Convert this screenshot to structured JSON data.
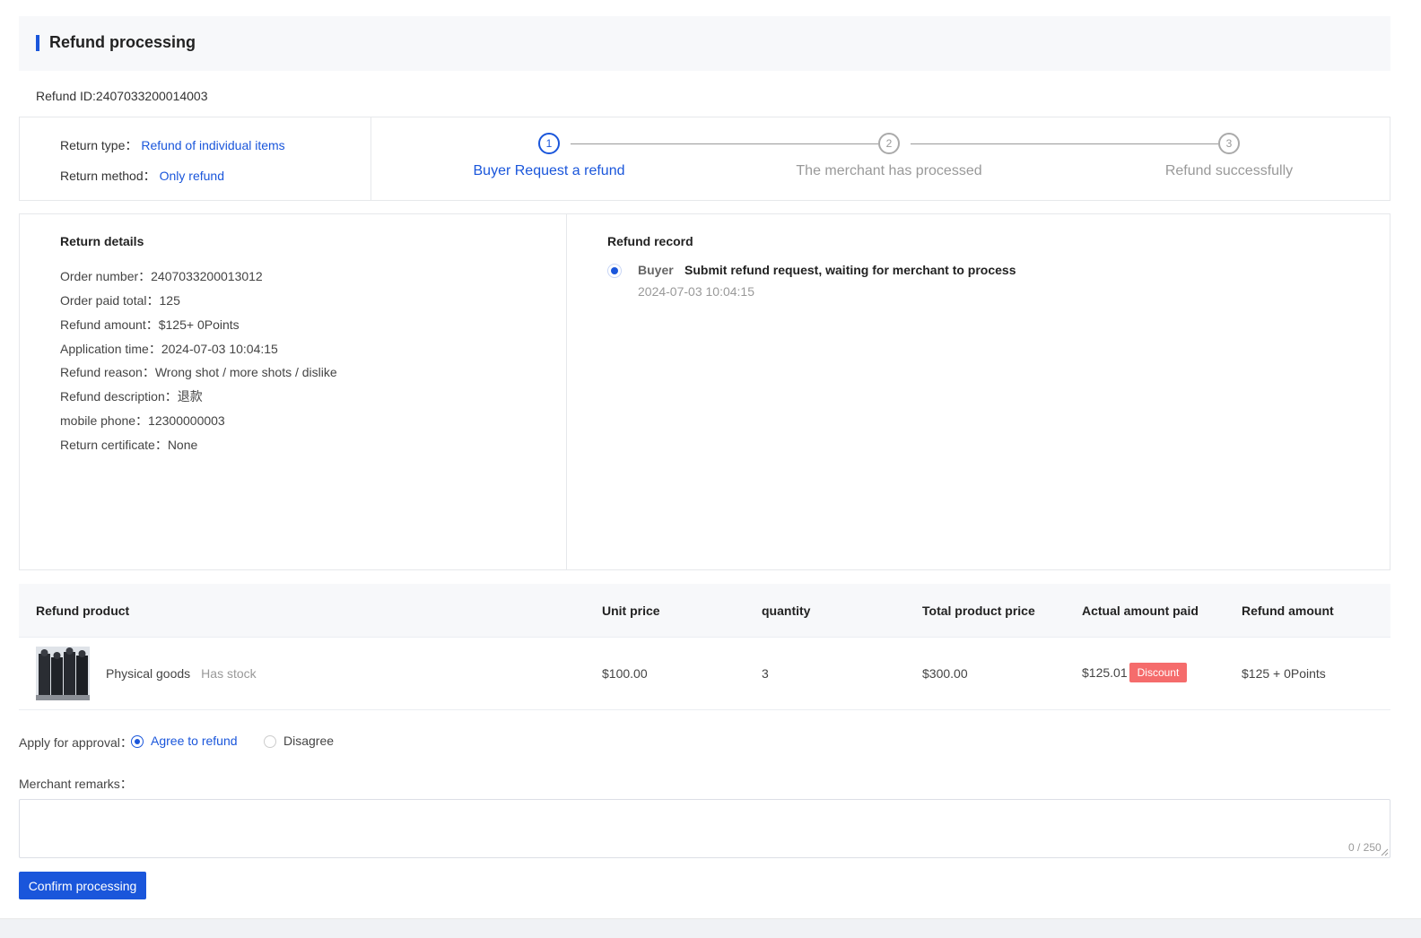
{
  "header": {
    "title": "Refund processing"
  },
  "refund_id": "Refund ID:2407033200014003",
  "info": {
    "return_type_label": "Return type：",
    "return_type_value": "Refund of individual items",
    "return_method_label": "Return method：",
    "return_method_value": "Only refund"
  },
  "steps": [
    {
      "number": "1",
      "label": "Buyer Request a refund",
      "active": true
    },
    {
      "number": "2",
      "label": "The merchant has processed",
      "active": false
    },
    {
      "number": "3",
      "label": "Refund successfully",
      "active": false
    }
  ],
  "return_details": {
    "title": "Return details",
    "rows": [
      "Order number：2407033200013012",
      "Order paid total：125",
      "Refund amount：$125+ 0Points",
      "Application time：2024-07-03 10:04:15",
      "Refund reason：Wrong shot / more shots / dislike",
      "Refund description：退款",
      "mobile phone：12300000003",
      "Return certificate：None"
    ]
  },
  "refund_record": {
    "title": "Refund record",
    "entries": [
      {
        "who": "Buyer",
        "text": "Submit refund request, waiting for merchant to process",
        "time": "2024-07-03 10:04:15"
      }
    ]
  },
  "table": {
    "headers": [
      "Refund product",
      "Unit price",
      "quantity",
      "Total product price",
      "Actual amount paid",
      "Refund amount"
    ],
    "rows": [
      {
        "product_name": "Physical goods",
        "stock": "Has stock",
        "unit_price": "$100.00",
        "quantity": "3",
        "total_price": "$300.00",
        "actual_paid": "$125.01",
        "discount_badge": "Discount",
        "refund_amount": "$125 + 0Points"
      }
    ]
  },
  "approval": {
    "label": "Apply for approval：",
    "options": [
      {
        "label": "Agree to refund",
        "selected": true
      },
      {
        "label": "Disagree",
        "selected": false
      }
    ]
  },
  "remarks": {
    "label": "Merchant remarks：",
    "value": "",
    "counter": "0 / 250"
  },
  "confirm_button": "Confirm processing",
  "colors": {
    "primary": "#1a56db",
    "danger": "#f56c6c",
    "muted": "#999999"
  }
}
